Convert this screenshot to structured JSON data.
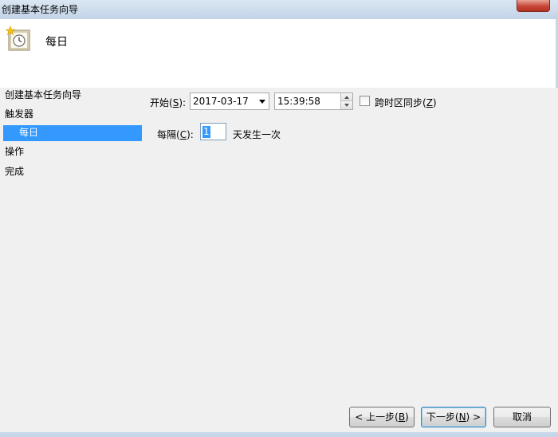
{
  "window": {
    "title": "创建基本任务向导"
  },
  "header": {
    "title": "每日",
    "icon": "calendar-clock-icon"
  },
  "steps": [
    {
      "label": "创建基本任务向导"
    },
    {
      "label": "触发器"
    },
    {
      "label": "每日"
    },
    {
      "label": "操作"
    },
    {
      "label": "完成"
    }
  ],
  "start": {
    "label_prefix": "开始(",
    "label_key": "S",
    "label_suffix": "):",
    "date": "2017-03-17",
    "time": "15:39:58"
  },
  "sync": {
    "label_prefix": "跨时区同步(",
    "label_key": "Z",
    "label_suffix": ")",
    "checked": false
  },
  "recur": {
    "label_prefix": "每隔(",
    "label_key": "C",
    "label_suffix": "):",
    "value": "1",
    "suffix": "天发生一次"
  },
  "buttons": {
    "back": {
      "prefix": "< 上一步(",
      "key": "B",
      "suffix": ")"
    },
    "next": {
      "prefix": "下一步(",
      "key": "N",
      "suffix": ") >"
    },
    "cancel": "取消"
  },
  "colors": {
    "selection": "#3399ff",
    "background": "#f0f0f0"
  }
}
